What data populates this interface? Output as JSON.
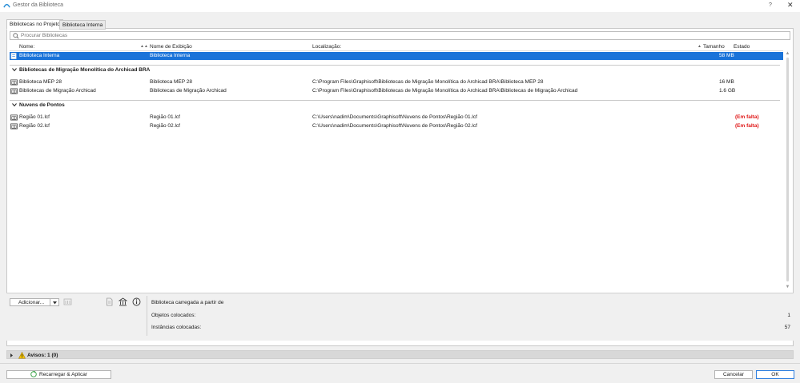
{
  "window": {
    "title": "Gestor da Biblioteca",
    "help": "?",
    "close": "✕"
  },
  "tabs": [
    {
      "label": "Bibliotecas no Projeto",
      "active": true
    },
    {
      "label": "Biblioteca Interna",
      "active": false
    }
  ],
  "search": {
    "placeholder": "Procurar Bibliotecas",
    "value": ""
  },
  "table": {
    "columns": {
      "name": "Nome:",
      "display": "Nome de Exibição",
      "location": "Localização:",
      "size": "Tamanho",
      "status": "Estado"
    },
    "selected_row": {
      "name": "Biblioteca Interna",
      "display": "Biblioteca Interna",
      "location": "",
      "size": "58 MB",
      "status": ""
    },
    "groups": [
      {
        "title": "Bibliotecas de Migração Monolítica do Archicad BRA",
        "rows": [
          {
            "name": "Biblioteca MEP 28",
            "display": "Biblioteca MEP 28",
            "location": "C:\\Program Files\\Graphisoft\\Bibliotecas de Migração Monolítica do Archicad BRA\\Biblioteca MEP 28",
            "size": "16 MB",
            "status": ""
          },
          {
            "name": "Bibliotecas de Migração Archicad",
            "display": "Bibliotecas de Migração Archicad",
            "location": "C:\\Program Files\\Graphisoft\\Bibliotecas de Migração Monolítica do Archicad BRA\\Bibliotecas de Migração Archicad",
            "size": "1.6 GB",
            "status": ""
          }
        ]
      },
      {
        "title": "Nuvens de Pontos",
        "rows": [
          {
            "name": "Região 01.lcf",
            "display": "Região 01.lcf",
            "location": "C:\\Users\\nadim\\Documents\\Graphisoft\\Nuvens de Pontos\\Região 01.lcf",
            "size": "",
            "status": "(Em falta)"
          },
          {
            "name": "Região 02.lcf",
            "display": "Região 02.lcf",
            "location": "C:\\Users\\nadim\\Documents\\Graphisoft\\Nuvens de Pontos\\Região 02.lcf",
            "size": "",
            "status": "(Em falta)"
          }
        ]
      }
    ]
  },
  "toolbar": {
    "add_label": "Adicionar..."
  },
  "info": {
    "loaded_from_label": "Biblioteca carregada a partir de",
    "objects_label": "Objetos colocados:",
    "objects_value": "1",
    "instances_label": "Instâncias colocadas:",
    "instances_value": "57"
  },
  "warnings": {
    "label": "Avisos: 1 (0)"
  },
  "footer": {
    "reload_label": "Recarregar & Aplicar",
    "cancel_label": "Cancelar",
    "ok_label": "OK"
  },
  "colors": {
    "selection": "#1a73d9",
    "missing": "#e01818",
    "accent": "#2d7fe0"
  },
  "icons": [
    "archicad-app-icon",
    "search-icon",
    "library-folder-icon",
    "chevron-down-icon",
    "warning-icon",
    "reload-icon",
    "info-icon"
  ]
}
